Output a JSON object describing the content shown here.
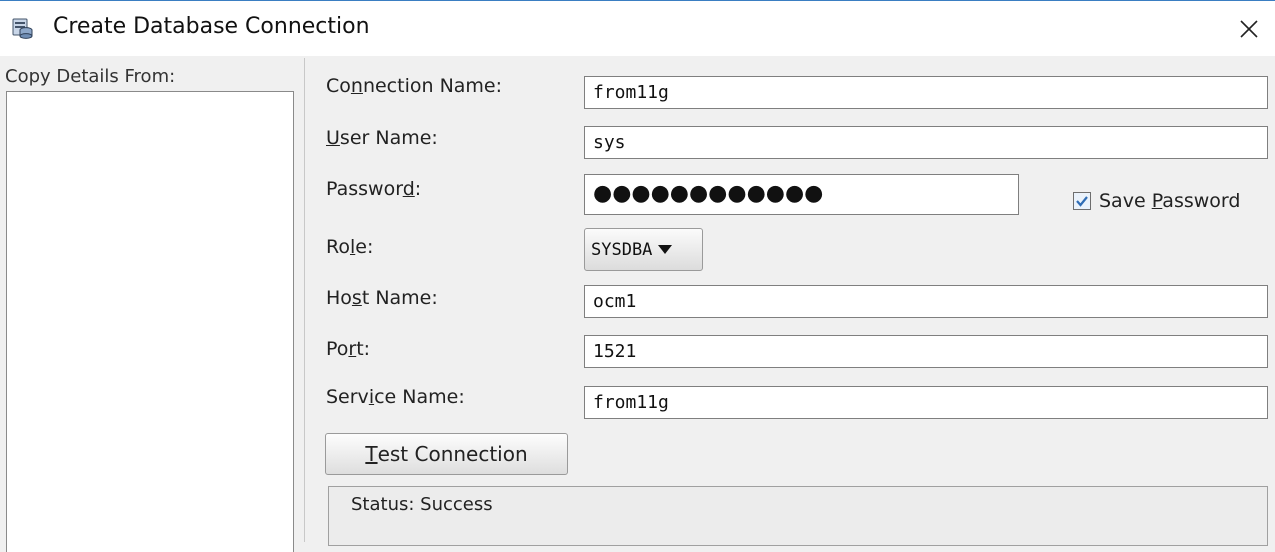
{
  "window": {
    "title": "Create Database Connection",
    "icon": "database-icon",
    "close_icon": "close-icon"
  },
  "copy_details": {
    "label": "Copy Details From:"
  },
  "form": {
    "connection_name": {
      "label_pre": "Co",
      "label_u": "n",
      "label_post": "nection Name:",
      "value": "from11g"
    },
    "user_name": {
      "label_pre": "",
      "label_u": "U",
      "label_post": "ser Name:",
      "value": "sys"
    },
    "password": {
      "label_pre": "Passwor",
      "label_u": "d",
      "label_post": ":",
      "value": "●●●●●●●●●●●●"
    },
    "save_password": {
      "label_pre": "Save ",
      "label_u": "P",
      "label_post": "assword",
      "checked": true
    },
    "role": {
      "label_pre": "Ro",
      "label_u": "l",
      "label_post": "e:",
      "value": "SYSDBA"
    },
    "host_name": {
      "label_pre": "Ho",
      "label_u": "s",
      "label_post": "t Name:",
      "value": "ocm1"
    },
    "port": {
      "label_pre": "Po",
      "label_u": "r",
      "label_post": "t:",
      "value": "1521"
    },
    "service_name": {
      "label_pre": "Serv",
      "label_u": "i",
      "label_post": "ce Name:",
      "value": "from11g"
    }
  },
  "test_button": {
    "label_pre": "",
    "label_u": "T",
    "label_post": "est Connection"
  },
  "status": {
    "text": "Status: Success"
  },
  "colors": {
    "accent": "#3a7ec2",
    "check": "#2f6db5"
  }
}
